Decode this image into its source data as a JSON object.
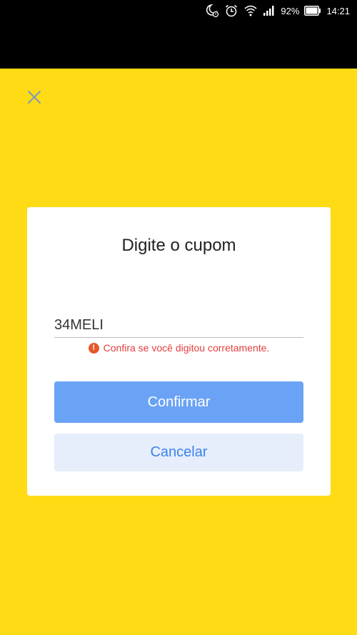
{
  "status_bar": {
    "battery_percent": "92%",
    "time": "14:21",
    "icons": [
      "moon-alarm-icon",
      "alarm-clock-icon",
      "wifi-icon",
      "signal-icon",
      "battery-icon"
    ]
  },
  "header": {
    "close_icon": "close-icon"
  },
  "dialog": {
    "title": "Digite o cupom",
    "coupon_value": "34MELI",
    "error_message": "Confira se você digitou corretamente.",
    "error_icon_glyph": "!",
    "confirm_label": "Confirmar",
    "cancel_label": "Cancelar"
  },
  "colors": {
    "background": "#ffdb15",
    "primary": "#6aa2f5",
    "secondary_bg": "#e6eefb",
    "secondary_text": "#3c82ef",
    "error": "#e33e3e"
  }
}
